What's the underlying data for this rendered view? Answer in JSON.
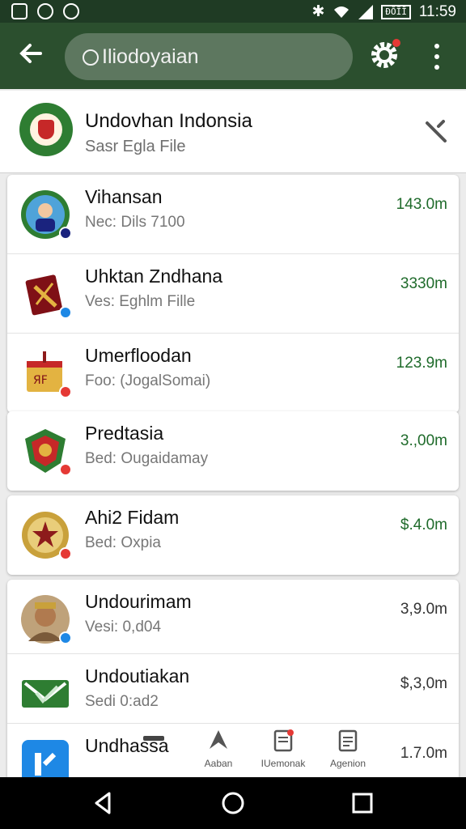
{
  "status_bar": {
    "battery_text": "ĐŎĨĨ",
    "time": "11:59",
    "icons": [
      "gallery-icon",
      "chrome-icon",
      "camera-icon",
      "bluetooth-icon",
      "wifi-icon",
      "signal-icon",
      "battery-icon"
    ]
  },
  "app_bar": {
    "search_text": "Iliodoyaian",
    "accent": "#2b4f2e"
  },
  "header": {
    "title": "Undovhan Indonsia",
    "subtitle": "Sasr Egla File"
  },
  "list": [
    {
      "name": "Vihansan",
      "sub": "Nec: Dils 7100",
      "size": "143.0m",
      "badge": "navy"
    },
    {
      "name": "Uhktan Zndhana",
      "sub": "Ves: Eghlm Fille",
      "size": "3330m",
      "badge": "blue"
    },
    {
      "name": "Umerfloodan",
      "sub": "Foo: (JogalSomai)",
      "size": "123.9m",
      "badge": "red"
    },
    {
      "name": "Predtasia",
      "sub": "Bed: Ougaidamay",
      "size": "3.,00m",
      "badge": "red"
    },
    {
      "name": "Ahi2 Fidam",
      "sub": "Bed: Oxpia",
      "size": "$.4.0m",
      "badge": "red"
    },
    {
      "name": "Undourimam",
      "sub": "Vesi: 0,d04",
      "size": "3,9.0m",
      "badge": "blue"
    },
    {
      "name": "Undoutiakan",
      "sub": "Sedi 0:ad2",
      "size": "$,3,0m",
      "badge": ""
    },
    {
      "name": "Undhassa",
      "sub": "",
      "size": "1.7.0m",
      "badge": ""
    }
  ],
  "tabs": [
    {
      "label": "",
      "icon": "folder-icon"
    },
    {
      "label": "Aaban",
      "icon": "send-icon"
    },
    {
      "label": "IUemonak",
      "icon": "doc-notify-icon"
    },
    {
      "label": "Agenion",
      "icon": "document-icon"
    }
  ],
  "nav": [
    "back-icon",
    "home-icon",
    "recents-icon"
  ]
}
